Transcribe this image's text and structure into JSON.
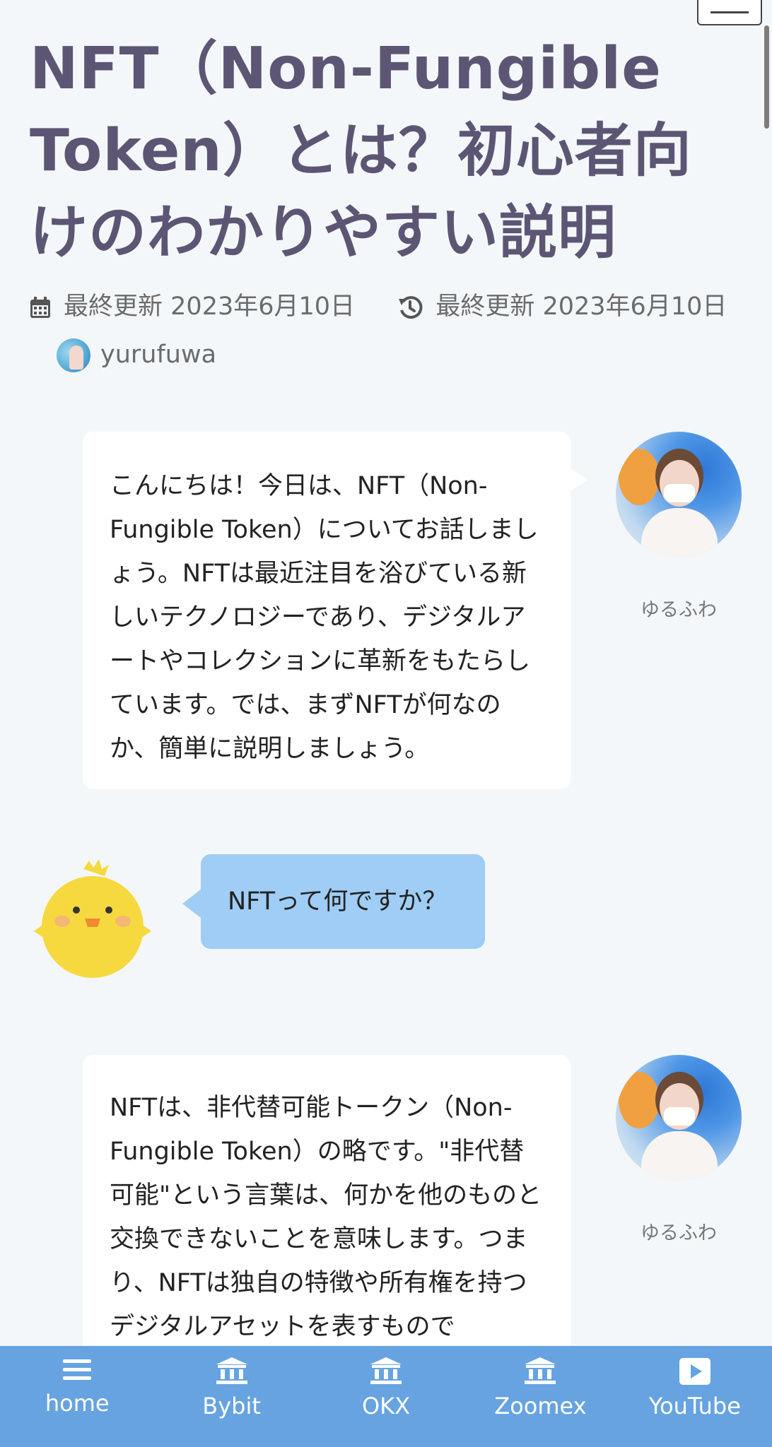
{
  "title": "NFT（Non-Fungible Token）とは？初心者向けのわかりやすい説明",
  "meta": {
    "published_label": "最終更新",
    "published_date": "2023年6月10日",
    "updated_label": "最終更新",
    "updated_date": "2023年6月10日",
    "author": "yurufuwa"
  },
  "chat": [
    {
      "speaker": "ゆるふわ",
      "text": "こんにちは！今日は、NFT（Non-Fungible Token）についてお話しましょう。NFTは最近注目を浴びている新しいテクノロジーであり、デジタルアートやコレクションに革新をもたらしています。では、まずNFTが何なのか、簡単に説明しましょう。"
    },
    {
      "speaker": "",
      "text": "NFTって何ですか？"
    },
    {
      "speaker": "ゆるふわ",
      "text": "NFTは、非代替可能トークン（Non-Fungible Token）の略です。\"非代替可能\"という言葉は、何かを他のものと交換できないことを意味します。つまり、NFTは独自の特徴や所有権を持つデジタルアセットを表すもので"
    }
  ],
  "bottom_nav": [
    {
      "label": "home",
      "icon": "menu-icon"
    },
    {
      "label": "Bybit",
      "icon": "bank-icon"
    },
    {
      "label": "OKX",
      "icon": "bank-icon"
    },
    {
      "label": "Zoomex",
      "icon": "bank-icon"
    },
    {
      "label": "YouTube",
      "icon": "play-icon"
    }
  ],
  "colors": {
    "background": "#f4f7f9",
    "title": "#5c5674",
    "nav": "#66a3e0",
    "question_bubble": "#9fcdf5"
  }
}
